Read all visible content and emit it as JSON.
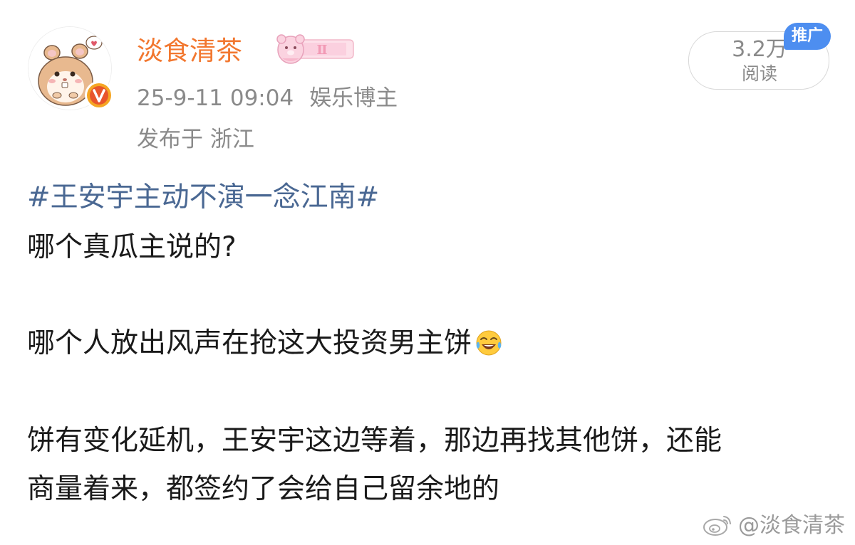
{
  "post": {
    "author": {
      "name": "淡食清茶",
      "avatar": "hamster-avatar",
      "verified_badge": "v-badge-icon",
      "member_badge": "vip-bear-badge"
    },
    "timestamp": "25-9-11 09:04",
    "category": "娱乐博主",
    "location": "发布于 浙江",
    "stats": {
      "read_count": "3.2万",
      "read_label": "阅读",
      "promo_label": "推广"
    },
    "hashtag": "#王安宇主动不演一念江南#",
    "lines": [
      "哪个真瓜主说的?",
      "哪个人放出风声在抢这大投资男主饼",
      "饼有变化延机，王安宇这边等着，那边再找其他饼，还能",
      "商量着来，都签约了会给自己留余地的"
    ],
    "line2_emoji": "laughing-crying-emoji"
  },
  "watermark": {
    "text": "@淡食清茶",
    "logo": "weibo-logo-icon"
  },
  "colors": {
    "username": "#f2772f",
    "hashtag": "#4a6893",
    "meta": "#8a8a8a",
    "promo": "#4d8ef0"
  }
}
